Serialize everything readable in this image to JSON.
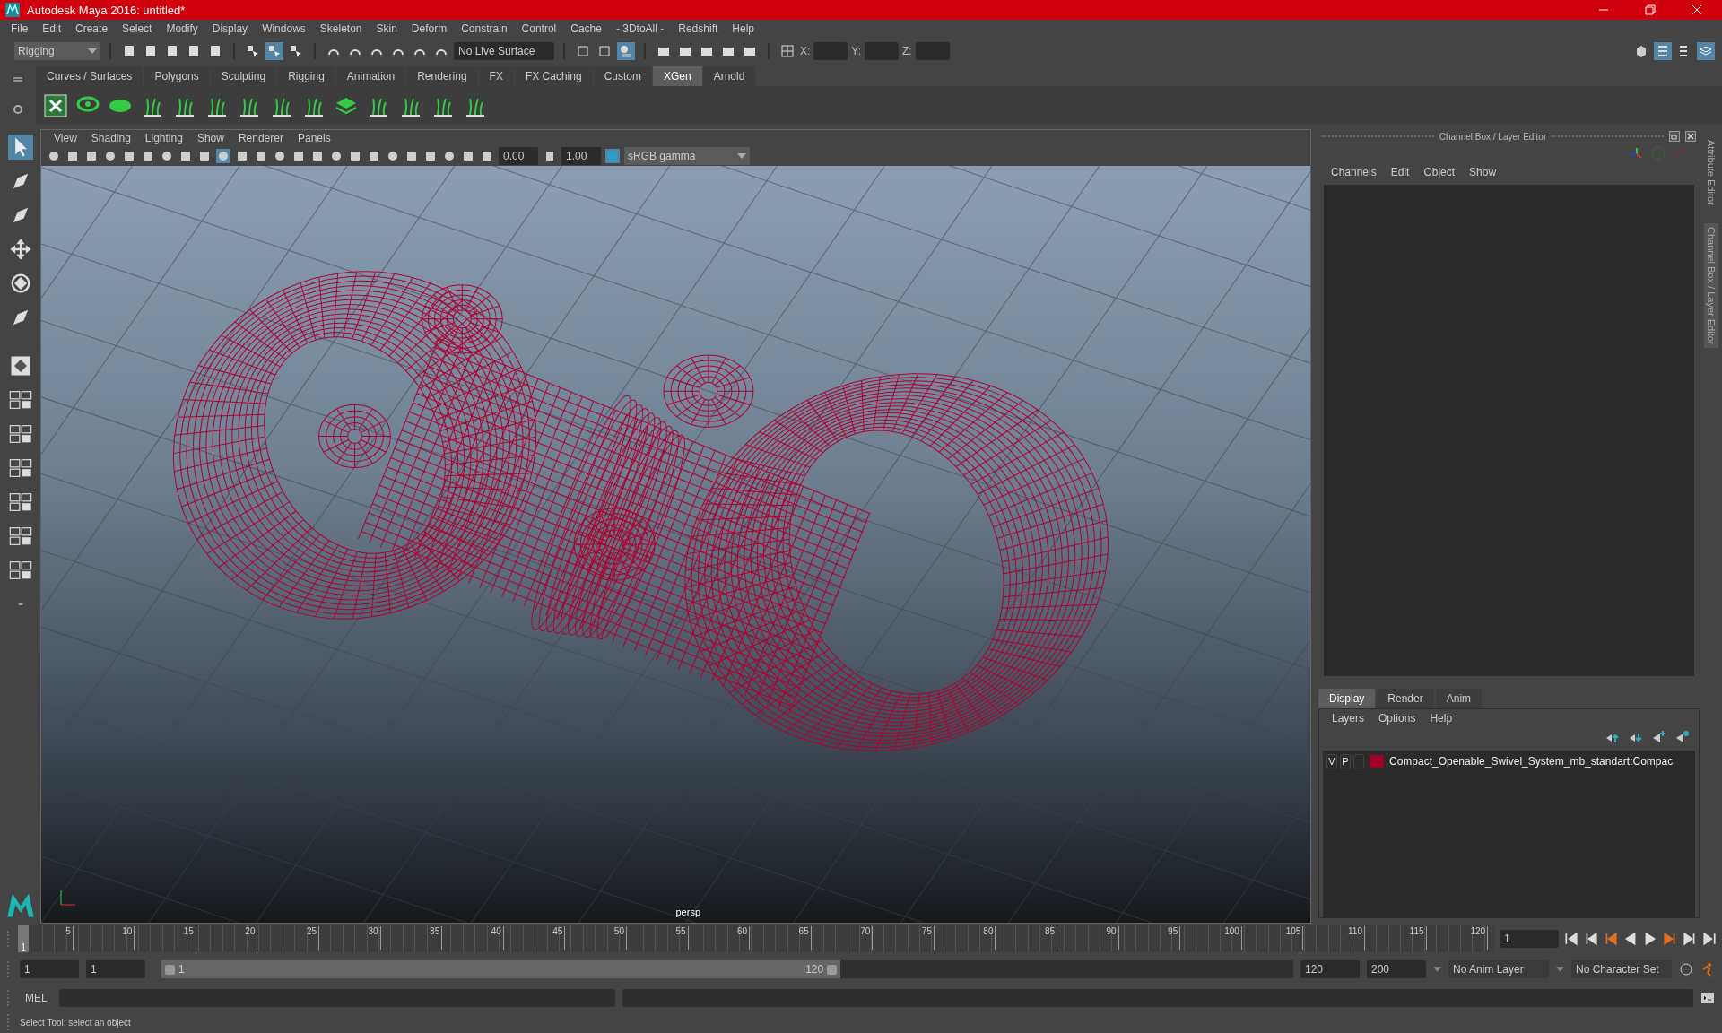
{
  "window": {
    "title": "Autodesk Maya 2016: untitled*"
  },
  "menu_bar": [
    "File",
    "Edit",
    "Create",
    "Select",
    "Modify",
    "Display",
    "Windows",
    "Skeleton",
    "Skin",
    "Deform",
    "Constrain",
    "Control",
    "Cache",
    "- 3DtoAll -",
    "Redshift",
    "Help"
  ],
  "status_line": {
    "mode": "Rigging",
    "live_surface": "No Live Surface",
    "coords": [
      "X:",
      "Y:",
      "Z:"
    ]
  },
  "shelf_tabs": [
    {
      "label": "Curves / Surfaces",
      "selected": false
    },
    {
      "label": "Polygons",
      "selected": false
    },
    {
      "label": "Sculpting",
      "selected": false
    },
    {
      "label": "Rigging",
      "selected": false
    },
    {
      "label": "Animation",
      "selected": false
    },
    {
      "label": "Rendering",
      "selected": false
    },
    {
      "label": "FX",
      "selected": false
    },
    {
      "label": "FX Caching",
      "selected": false
    },
    {
      "label": "Custom",
      "selected": false
    },
    {
      "label": "XGen",
      "selected": true
    },
    {
      "label": "Arnold",
      "selected": false
    }
  ],
  "viewport": {
    "menus": [
      "View",
      "Shading",
      "Lighting",
      "Show",
      "Renderer",
      "Panels"
    ],
    "exposure": "0.00",
    "gamma": "1.00",
    "color_space": "sRGB gamma",
    "camera": "persp"
  },
  "channel_box": {
    "title": "Channel Box / Layer Editor",
    "menus": [
      "Channels",
      "Edit",
      "Object",
      "Show"
    ]
  },
  "side_tabs": [
    "Attribute Editor",
    "Channel Box / Layer Editor"
  ],
  "layer_editor": {
    "tabs": [
      {
        "label": "Display",
        "selected": true
      },
      {
        "label": "Render",
        "selected": false
      },
      {
        "label": "Anim",
        "selected": false
      }
    ],
    "menus": [
      "Layers",
      "Options",
      "Help"
    ],
    "layers": [
      {
        "visible": "V",
        "playback": "P",
        "color": "#a0002a",
        "name": "Compact_Openable_Swivel_System_mb_standart:Compac"
      }
    ]
  },
  "timeline": {
    "current": "1",
    "level": 0,
    "ticks": [
      "5",
      "10",
      "15",
      "20",
      "25",
      "30",
      "35",
      "40",
      "45",
      "50",
      "55",
      "60",
      "65",
      "70",
      "75",
      "80",
      "85",
      "90",
      "95",
      "100",
      "105",
      "110",
      "115",
      "120"
    ],
    "frame": "1"
  },
  "range": {
    "level": 0.6,
    "start": "1",
    "playback_start": "1",
    "slider_start": "1",
    "slider_end": "120",
    "playback_end": "120",
    "end": "200",
    "anim_layer": "No Anim Layer",
    "character_set": "No Character Set"
  },
  "command_line": {
    "label": "MEL"
  },
  "status_bar": "Select Tool: select an object"
}
